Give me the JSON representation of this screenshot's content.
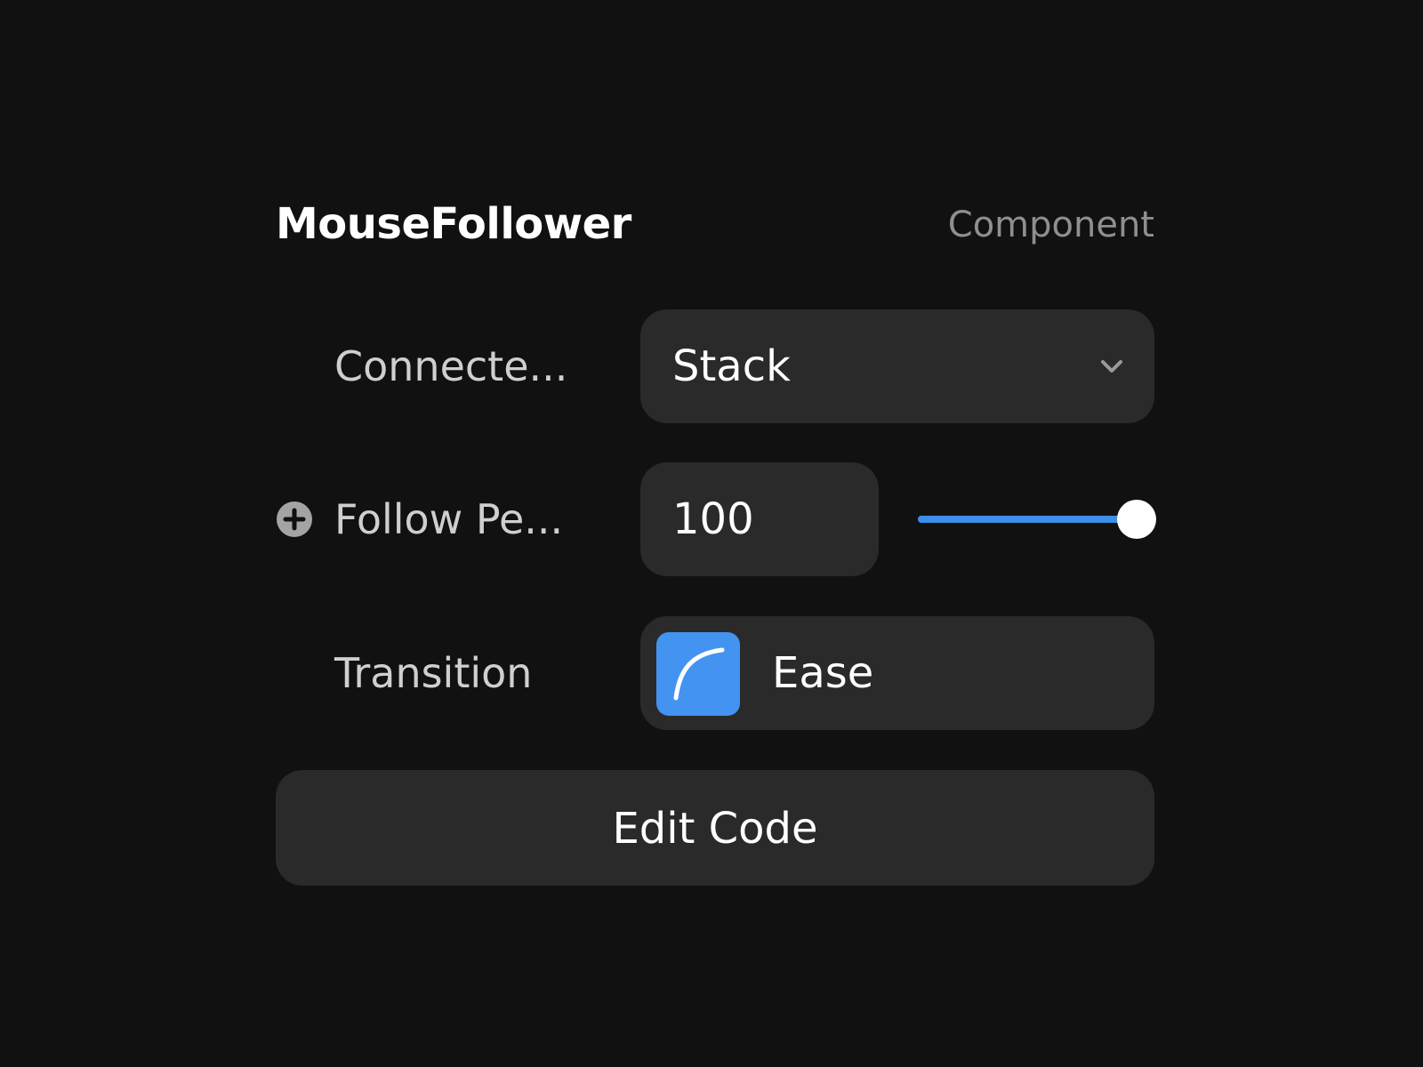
{
  "header": {
    "title": "MouseFollower",
    "subtitle": "Component"
  },
  "properties": {
    "connected": {
      "label": "Connecte...",
      "value": "Stack",
      "icon": "chevron-down-icon"
    },
    "follow": {
      "label": "Follow Pe...",
      "value": "100",
      "slider_fraction": 1.0,
      "icon": "plus-circle-icon",
      "accent": "#3b8ee9"
    },
    "transition": {
      "label": "Transition",
      "value": "Ease",
      "icon": "ease-curve-icon",
      "swatch_color": "#4394f1"
    }
  },
  "actions": {
    "edit_code_label": "Edit Code"
  }
}
